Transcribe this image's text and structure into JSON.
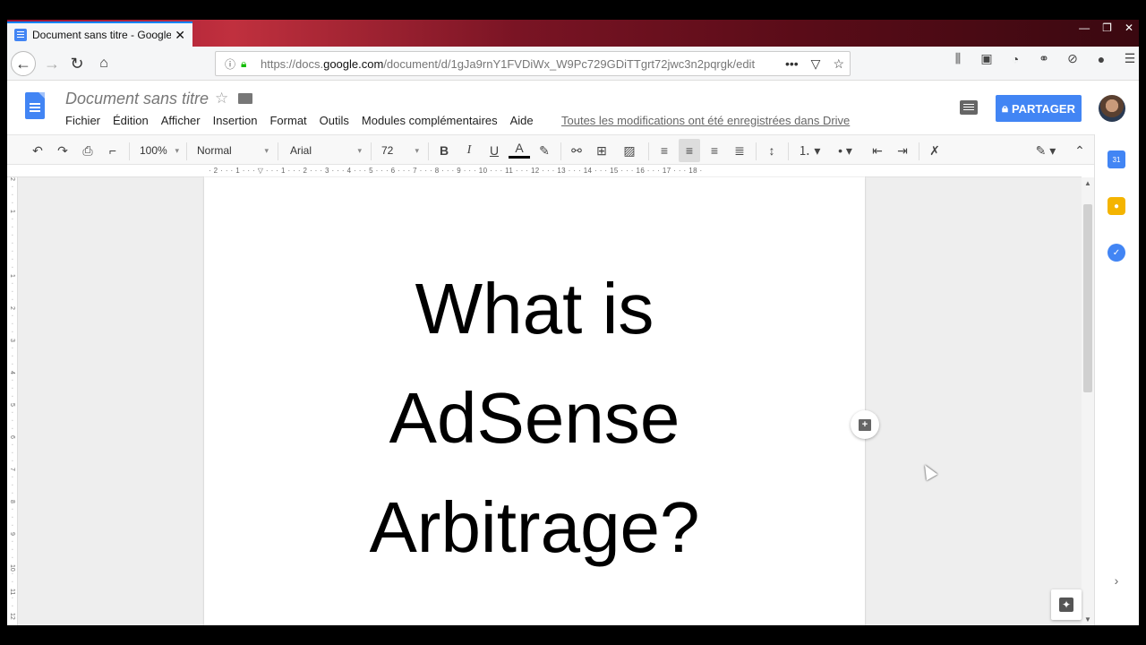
{
  "browser": {
    "active_tab_title": "Document sans titre - Google D",
    "tab_close": "✕",
    "url_prefix": "https://docs.",
    "url_domain": "google.com",
    "url_path": "/document/d/1gJa9rnY1FVDiWx_W9Pc729GDiTTgrt72jwc3n2pqrgk/edit"
  },
  "docs": {
    "title": "Document sans titre",
    "menu": [
      "Fichier",
      "Édition",
      "Afficher",
      "Insertion",
      "Format",
      "Outils",
      "Modules complémentaires",
      "Aide"
    ],
    "saved_status": "Toutes les modifications ont été enregistrées dans Drive",
    "share_label": "PARTAGER",
    "accent": "#4285f4"
  },
  "toolbar": {
    "zoom": "100%",
    "style": "Normal",
    "font": "Arial",
    "size": "72",
    "bold": "B",
    "italic": "I",
    "underline": "U",
    "text_color": "A"
  },
  "ruler": {
    "ticks": "· 2 · · · 1 · · · ▽ · · · 1 · · · 2 · · · 3 · · · 4 · · · 5 · · · 6 · · · 7 · · · 8 · · · 9 · · · 10 · · · 11 · · · 12 · · · 13 · · · 14 · · · 15 · · · 16 · · · 17 · · · 18 ·"
  },
  "document": {
    "line1": "What is",
    "line2": "AdSense",
    "line3": "Arbitrage?"
  },
  "sidepanel": {
    "calendar_day": "31"
  }
}
